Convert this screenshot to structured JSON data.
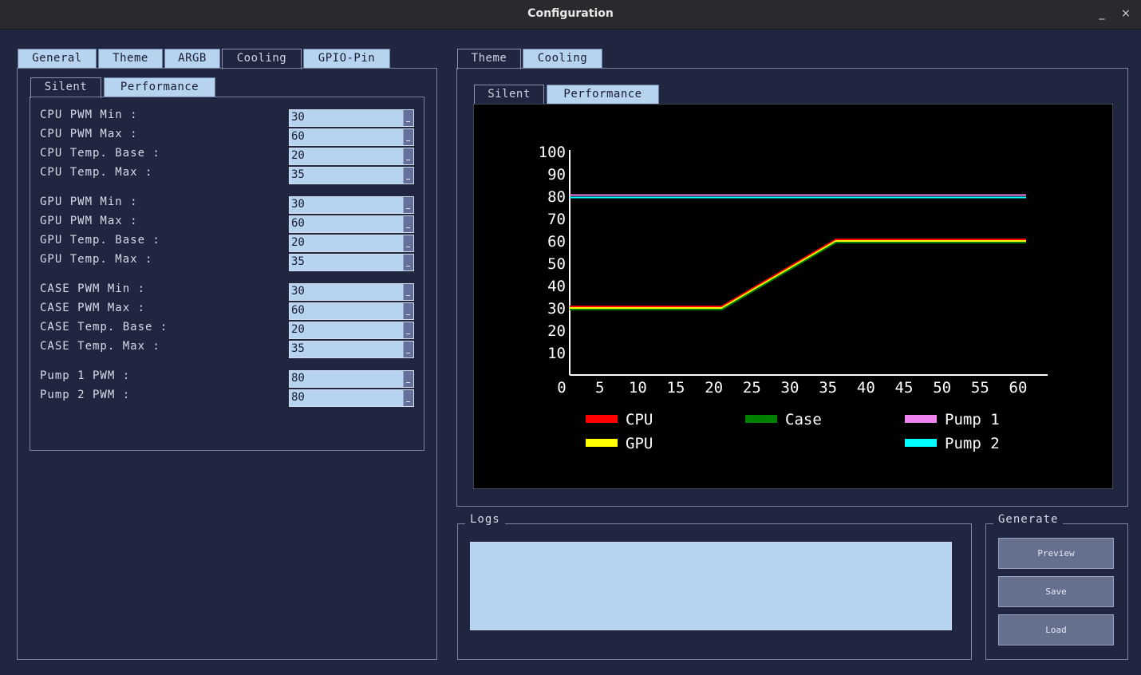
{
  "window": {
    "title": "Configuration",
    "minimize_label": "_",
    "close_label": "×"
  },
  "left": {
    "tabs": [
      "General",
      "Theme",
      "ARGB",
      "Cooling",
      "GPIO-Pin"
    ],
    "active_tab": "Cooling",
    "subtabs": [
      "Silent",
      "Performance"
    ],
    "active_subtab": "Silent",
    "fields": [
      {
        "label": "CPU PWM Min :",
        "value": "30"
      },
      {
        "label": "CPU PWM Max :",
        "value": "60"
      },
      {
        "label": "CPU Temp. Base :",
        "value": "20"
      },
      {
        "label": "CPU Temp. Max :",
        "value": "35"
      },
      {
        "label": "GPU PWM Min :",
        "value": "30"
      },
      {
        "label": "GPU PWM Max :",
        "value": "60"
      },
      {
        "label": "GPU Temp. Base :",
        "value": "20"
      },
      {
        "label": "GPU Temp. Max :",
        "value": "35"
      },
      {
        "label": "CASE PWM Min :",
        "value": "30"
      },
      {
        "label": "CASE PWM Max :",
        "value": "60"
      },
      {
        "label": "CASE Temp. Base :",
        "value": "20"
      },
      {
        "label": "CASE Temp. Max :",
        "value": "35"
      },
      {
        "label": "Pump 1 PWM :",
        "value": "80"
      },
      {
        "label": "Pump 2 PWM :",
        "value": "80"
      }
    ]
  },
  "right": {
    "tabs": [
      "Theme",
      "Cooling"
    ],
    "active_tab": "Theme",
    "subtabs": [
      "Silent",
      "Performance"
    ],
    "active_subtab": "Silent"
  },
  "logs": {
    "title": "Logs",
    "content": ""
  },
  "generate": {
    "title": "Generate",
    "preview_label": "Preview",
    "save_label": "Save",
    "load_label": "Load"
  },
  "chart_data": {
    "type": "line",
    "background": "#000000",
    "xlim": [
      0,
      60
    ],
    "ylim": [
      0,
      100
    ],
    "xticks": [
      0,
      5,
      10,
      15,
      20,
      25,
      30,
      35,
      40,
      45,
      50,
      55,
      60
    ],
    "yticks": [
      10,
      20,
      30,
      40,
      50,
      60,
      70,
      80,
      90,
      100
    ],
    "series": [
      {
        "name": "CPU",
        "color": "#ff0000",
        "x": [
          0,
          20,
          35,
          60
        ],
        "y": [
          30,
          30,
          60,
          60
        ]
      },
      {
        "name": "GPU",
        "color": "#ffff00",
        "x": [
          0,
          20,
          35,
          60
        ],
        "y": [
          30,
          30,
          60,
          60
        ]
      },
      {
        "name": "Case",
        "color": "#008000",
        "x": [
          0,
          20,
          35,
          60
        ],
        "y": [
          30,
          30,
          60,
          60
        ]
      },
      {
        "name": "Pump 1",
        "color": "#ee82ee",
        "x": [
          0,
          60
        ],
        "y": [
          80,
          80
        ]
      },
      {
        "name": "Pump 2",
        "color": "#00ffff",
        "x": [
          0,
          60
        ],
        "y": [
          80,
          80
        ]
      }
    ],
    "legend": [
      {
        "name": "CPU",
        "color": "#ff0000"
      },
      {
        "name": "Case",
        "color": "#008000"
      },
      {
        "name": "Pump 1",
        "color": "#ee82ee"
      },
      {
        "name": "GPU",
        "color": "#ffff00"
      },
      {
        "name": "Pump 2",
        "color": "#00ffff"
      }
    ],
    "legend_placement": "bottom",
    "grid": false
  }
}
